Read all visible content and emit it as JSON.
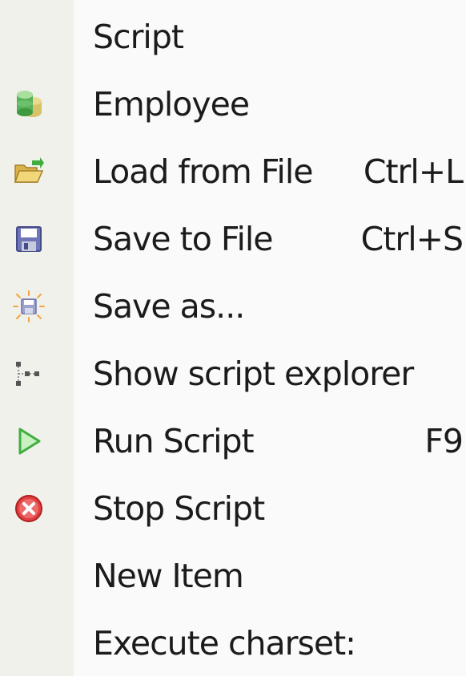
{
  "menu": {
    "items": [
      {
        "label": "Script",
        "shortcut": ""
      },
      {
        "label": "Employee",
        "shortcut": "",
        "icon": "database-icon"
      },
      {
        "label": "Load from File",
        "shortcut": "Ctrl+L",
        "icon": "open-folder-icon"
      },
      {
        "label": "Save to File",
        "shortcut": "Ctrl+S",
        "icon": "floppy-disk-icon"
      },
      {
        "label": "Save as...",
        "shortcut": "",
        "icon": "save-as-icon"
      },
      {
        "label": "Show script explorer",
        "shortcut": "",
        "icon": "tree-explorer-icon"
      },
      {
        "label": "Run Script",
        "shortcut": "F9",
        "icon": "play-icon"
      },
      {
        "label": "Stop Script",
        "shortcut": "",
        "icon": "stop-icon"
      },
      {
        "label": "New Item",
        "shortcut": ""
      },
      {
        "label": "Execute charset:",
        "shortcut": ""
      }
    ]
  },
  "colors": {
    "gutter": "#f1f1ec",
    "background": "#fafafa",
    "text": "#1b1b1b",
    "play_green": "#3fae3f",
    "stop_red": "#e04040"
  }
}
